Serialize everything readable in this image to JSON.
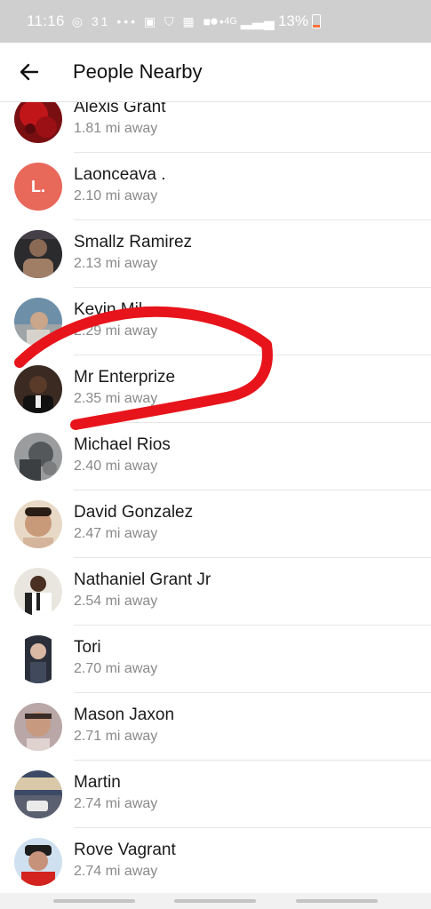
{
  "status_bar": {
    "time": "11:16",
    "icons": "◎ 31 ••• ▣ ⛉ ▦ ■ •",
    "network": "4G",
    "battery": "13%"
  },
  "app_bar": {
    "back_icon": "arrow-left-icon",
    "title": "People Nearby"
  },
  "people": [
    {
      "name": "Alexis Grant",
      "distance": "1.81 mi away"
    },
    {
      "name": "Laonceava .",
      "distance": "2.10 mi away",
      "avatar_letter": "L.",
      "avatar_color": "#e8685a"
    },
    {
      "name": "Smallz Ramirez",
      "distance": "2.13 mi away"
    },
    {
      "name": "Kevin Mil",
      "distance": "2.29 mi away"
    },
    {
      "name": "Mr Enterprize",
      "distance": "2.35 mi away"
    },
    {
      "name": "Michael Rios",
      "distance": "2.40 mi away"
    },
    {
      "name": "David Gonzalez",
      "distance": "2.47 mi away"
    },
    {
      "name": "Nathaniel Grant Jr",
      "distance": "2.54 mi away"
    },
    {
      "name": "Tori",
      "distance": "2.70 mi away"
    },
    {
      "name": "Mason Jaxon",
      "distance": "2.71 mi away"
    },
    {
      "name": "Martin",
      "distance": "2.74 mi away"
    },
    {
      "name": "Rove Vagrant",
      "distance": "2.74 mi away"
    }
  ],
  "annotation_color": "#e8141b"
}
